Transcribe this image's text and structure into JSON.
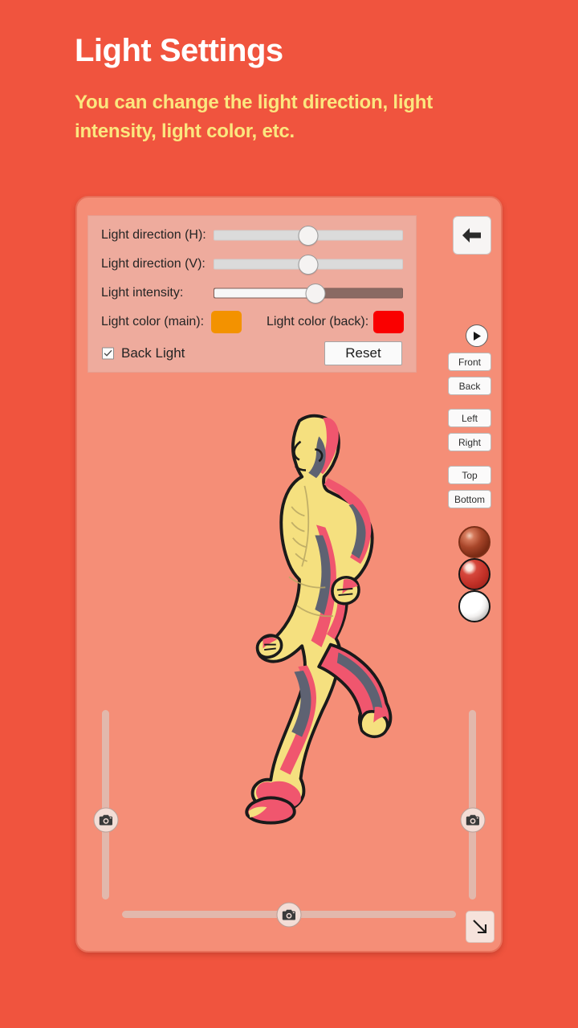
{
  "header": {
    "title": "Light Settings",
    "subtitle": "You can change the light direction, light intensity, light color, etc.",
    "title_color": "#ffffff",
    "subtitle_color": "#fbe77f",
    "background_color": "#f0543e"
  },
  "settings_panel": {
    "rows": [
      {
        "label": "Light direction (H):",
        "type": "slider",
        "value_pct": 50
      },
      {
        "label": "Light direction (V):",
        "type": "slider",
        "value_pct": 50
      },
      {
        "label": "Light intensity:",
        "type": "slider",
        "value_pct": 54
      }
    ],
    "color_main": {
      "label": "Light color (main):",
      "color": "#f39200"
    },
    "color_back": {
      "label": "Light color (back):",
      "color": "#fa0000"
    },
    "checkbox": {
      "label": "Back Light",
      "checked": true
    },
    "reset_label": "Reset"
  },
  "toolbar": {
    "back_icon": "back-arrow-icon",
    "play_icon": "play-icon",
    "view_buttons": [
      "Front",
      "Back",
      "Left",
      "Right",
      "Top",
      "Bottom"
    ],
    "material_spheres": [
      {
        "name": "glossy-brown-sphere",
        "base": "#8e3a22",
        "highlight": "#e8b9a2"
      },
      {
        "name": "matte-red-sphere",
        "base": "#c42f28",
        "highlight": "#ffeee8"
      },
      {
        "name": "white-sphere",
        "base": "#ffffff",
        "highlight": "#ffffff"
      }
    ]
  },
  "viewport": {
    "camera_icon": "camera-icon",
    "resize_icon": "resize-diagonal-icon",
    "left_slider_pct": 58,
    "right_slider_pct": 58,
    "bottom_slider_pct": 50,
    "model": "running-mannequin-figure"
  }
}
